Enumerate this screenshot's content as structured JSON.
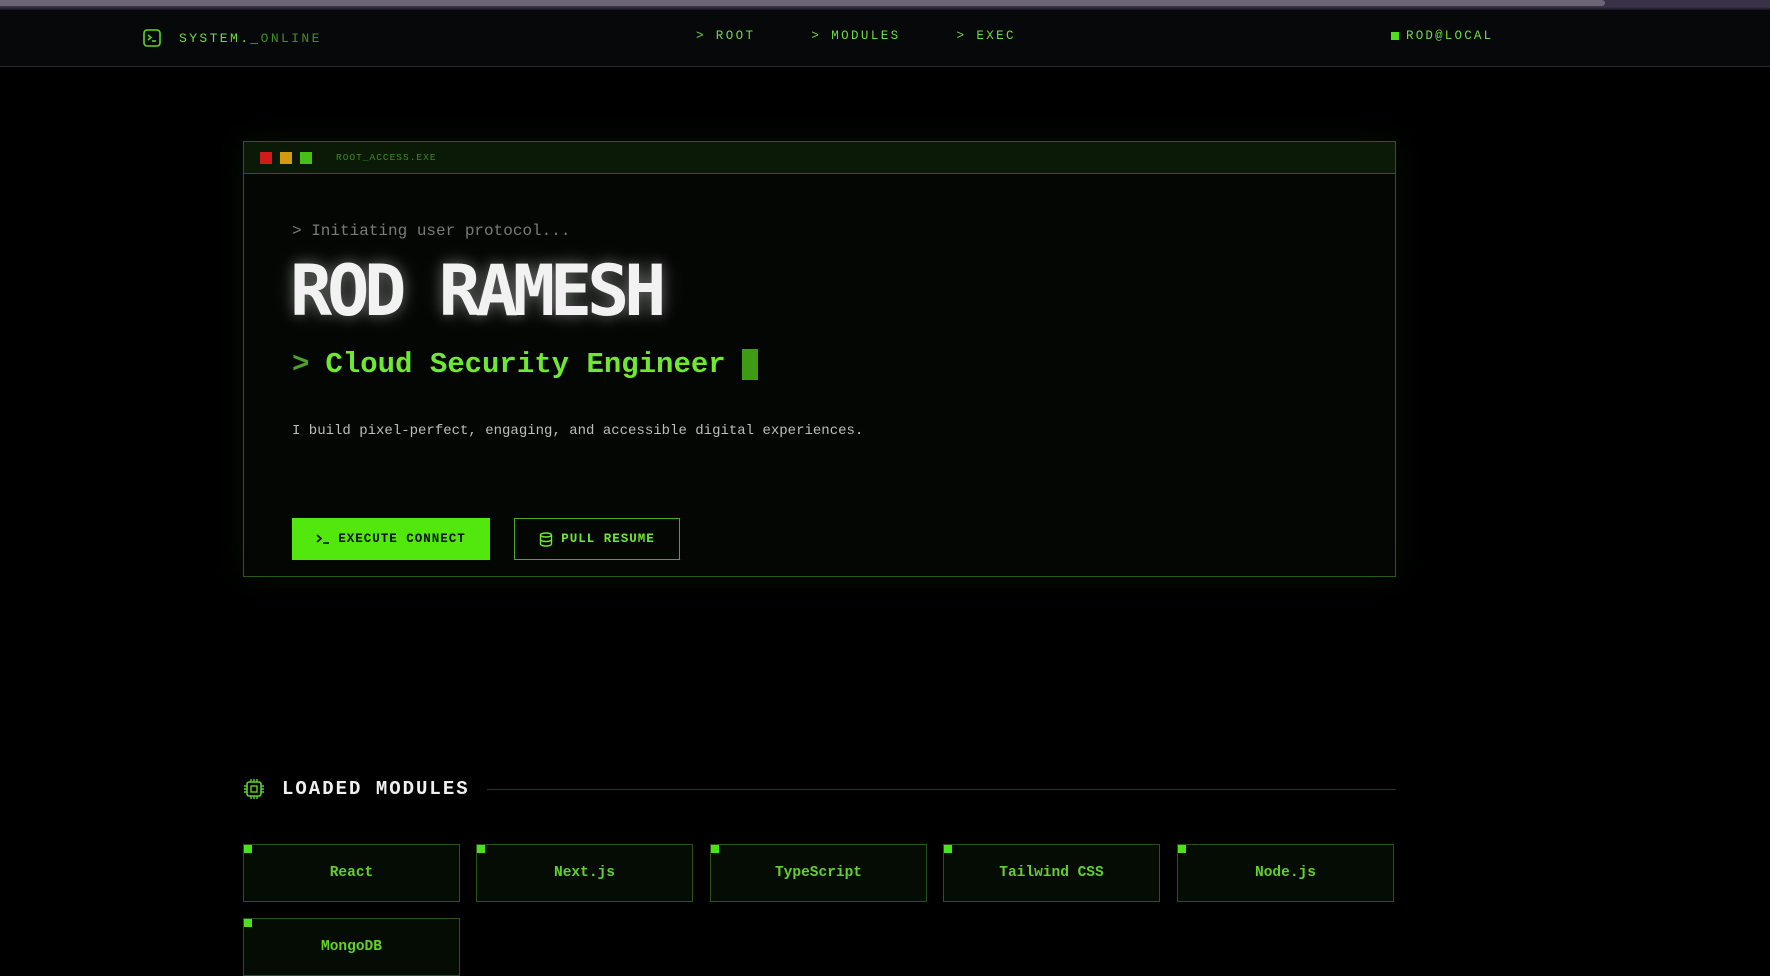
{
  "nav": {
    "brand_prefix": "SYSTEM._",
    "brand_status": "ONLINE",
    "links": [
      "> ROOT",
      "> MODULES",
      "> EXEC"
    ],
    "user": "ROD@LOCAL"
  },
  "window": {
    "title": "ROOT_ACCESS.EXE",
    "init_line": "> Initiating user protocol...",
    "name": "ROD RAMESH",
    "role_prompt": ">",
    "role": "Cloud Security Engineer",
    "description": "I build pixel-perfect, engaging, and accessible digital experiences.",
    "primary_button": "EXECUTE CONNECT",
    "secondary_button": "PULL RESUME"
  },
  "modules": {
    "title": "LOADED MODULES",
    "items": [
      "React",
      "Next.js",
      "TypeScript",
      "Tailwind CSS",
      "Node.js",
      "MongoDB"
    ]
  },
  "colors": {
    "accent": "#52e80d",
    "background": "#000000",
    "dot_red": "#d11a1a",
    "dot_yellow": "#d39a10",
    "dot_green": "#46c019"
  },
  "icons": {
    "brand": "terminal-square-icon",
    "primary_button": "terminal-prompt-icon",
    "secondary_button": "database-icon",
    "modules": "cpu-chip-icon"
  }
}
